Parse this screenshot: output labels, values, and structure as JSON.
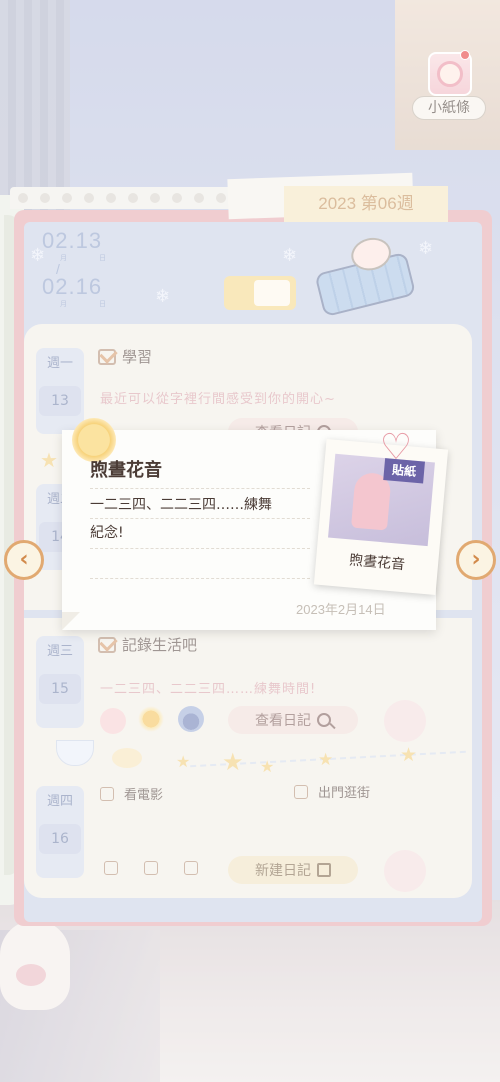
{
  "header": {
    "week_label": "2023 第06週",
    "note_button_label": "小紙條"
  },
  "date_range": {
    "start": "02.13",
    "end": "02.16",
    "month_label": "月",
    "day_label": "日",
    "separator": "/"
  },
  "days": [
    {
      "weekday": "週一",
      "date": "13",
      "entry_title": "學習",
      "entry_text": "最近可以從字裡行間感受到你的開心~",
      "action_label": "查看日記"
    },
    {
      "weekday": "週二",
      "date": "14"
    },
    {
      "weekday": "週三",
      "date": "15",
      "entry_title": "記錄生活吧",
      "entry_text": "一二三四、二二三四……練舞時間!",
      "action_label": "查看日記"
    },
    {
      "weekday": "週四",
      "date": "16",
      "todos": [
        "看電影",
        "出門逛街"
      ],
      "action_label": "新建日記"
    }
  ],
  "popup": {
    "title": "煦晝花音",
    "body_line1": "一二三四、二二三四……練舞",
    "body_line2": "紀念!",
    "date": "2023年2月14日",
    "sticker_badge": "貼紙",
    "sticker_name": "煦晝花音"
  },
  "nav": {
    "prev": "‹",
    "next": "›"
  },
  "icons": {
    "check": "checkmark-icon",
    "search": "magnifier-icon",
    "edit": "pencil-icon",
    "heart": "heart-icon"
  },
  "colors": {
    "accent_orange": "#d28a4b",
    "book_pink": "#e6a9af",
    "week_tab": "#f4e5c0",
    "date_blue": "#8ea0c8"
  }
}
